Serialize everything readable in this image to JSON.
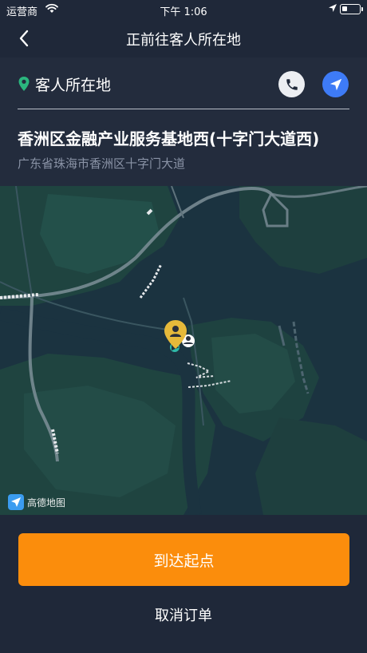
{
  "status_bar": {
    "carrier": "运营商",
    "time": "下午 1:06"
  },
  "nav": {
    "title": "正前往客人所在地"
  },
  "location_panel": {
    "label": "客人所在地",
    "address_title": "香洲区金融产业服务基地西(十字门大道西)",
    "address_detail": "广东省珠海市香洲区十字门大道"
  },
  "map": {
    "provider_logo": "高德地图"
  },
  "actions": {
    "arrive_label": "到达起点",
    "cancel_label": "取消订单"
  },
  "colors": {
    "background": "#1f2839",
    "panel": "#232c3d",
    "accent_orange": "#fb8d0c",
    "accent_blue": "#3e7bf6",
    "pin_green": "#2bb67e",
    "marker_yellow": "#e6b93a"
  },
  "icons": {
    "back": "chevron-left-icon",
    "pin": "location-pin-icon",
    "phone": "phone-icon",
    "navigate": "navigation-arrow-icon",
    "wifi": "wifi-icon",
    "location_services": "location-arrow-icon",
    "battery": "battery-icon"
  }
}
